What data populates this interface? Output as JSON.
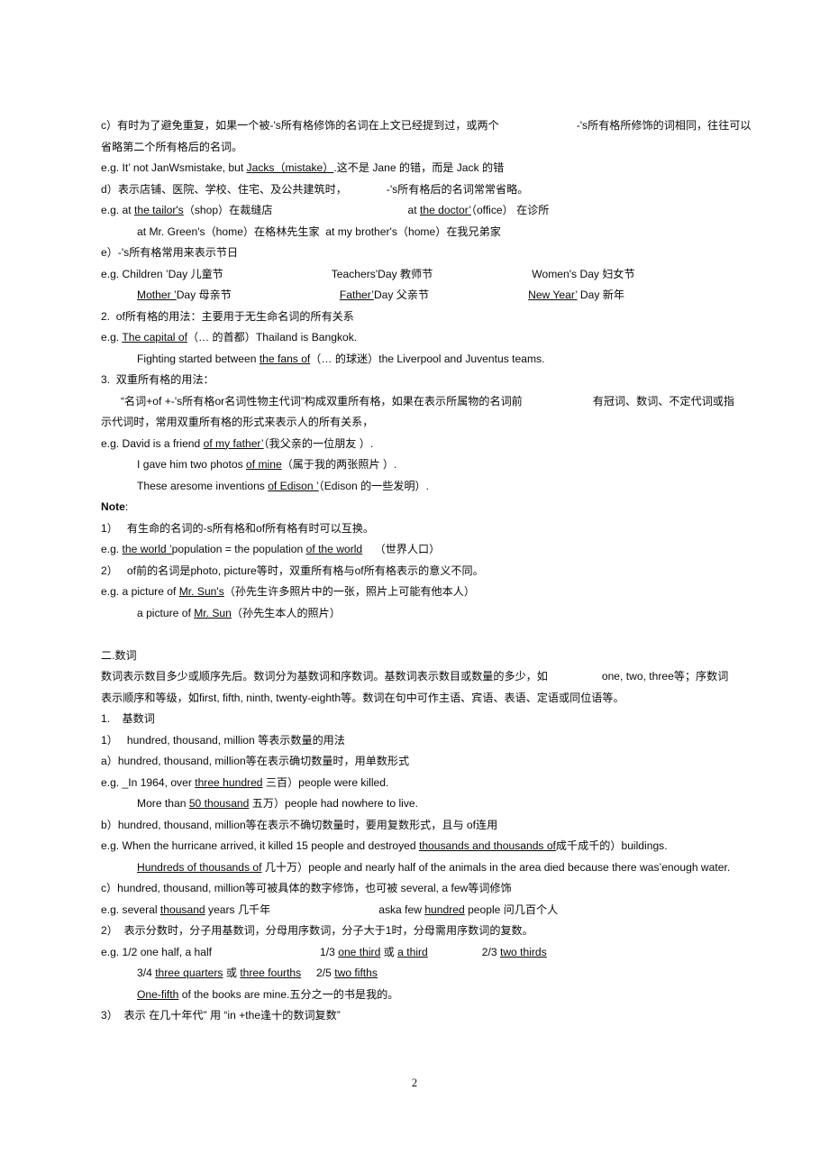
{
  "document": {
    "page_number": "2",
    "lines": [
      {
        "id": "l01",
        "indent": 1,
        "segments": [
          {
            "t": "c）有时为了避免重复，如果一个被-'s所有格修饰的名词在上文已经提到过，或两个"
          },
          {
            "t": "        ",
            "sp": "a"
          },
          {
            "t": "-'s所有格所修饰的词相同，往往可以"
          }
        ]
      },
      {
        "id": "l02",
        "indent": 1,
        "segments": [
          {
            "t": "省略第二个所有格后的名词。"
          }
        ]
      },
      {
        "id": "l03",
        "indent": 1,
        "segments": [
          {
            "t": "e.g. It’ not JanWsmistake, but "
          },
          {
            "t": "Jacks（mistake）",
            "u": true
          },
          {
            "t": ".这不是 Jane 的错，而是 Jack 的错"
          }
        ]
      },
      {
        "id": "l04",
        "indent": 1,
        "segments": [
          {
            "t": "d）表示店铺、医院、学校、住宅、及公共建筑时，"
          },
          {
            "t": "     ",
            "sp": "g"
          },
          {
            "t": "-'s所有格后的名词常常省略。"
          }
        ]
      },
      {
        "id": "l05",
        "indent": 1,
        "segments": [
          {
            "t": "e.g. at "
          },
          {
            "t": "the tailor's",
            "u": true
          },
          {
            "t": "（shop）在裁缝店"
          },
          {
            "t": "        ",
            "sp": "b"
          },
          {
            "t": "at "
          },
          {
            "t": "the doctor’",
            "u": true
          },
          {
            "t": "（office） 在诊所"
          }
        ]
      },
      {
        "id": "l06",
        "indent": 3,
        "segments": [
          {
            "t": "at Mr. Green's（home）在格林先生家  at my brother's（home）在我兄弟家"
          }
        ]
      },
      {
        "id": "l07",
        "indent": 1,
        "segments": [
          {
            "t": "e）-'s所有格常用来表示节日"
          }
        ]
      },
      {
        "id": "l08",
        "indent": 1,
        "segments": [
          {
            "t": "e.g. Children ’Day 儿童节"
          },
          {
            "t": "       ",
            "sp": "c"
          },
          {
            "t": "Teachers'Day 教师节"
          },
          {
            "t": "       ",
            "sp": "d"
          },
          {
            "t": "Women's Day 妇女节"
          }
        ]
      },
      {
        "id": "l09",
        "indent": 3,
        "segments": [
          {
            "t": "Mother ’",
            "u": true
          },
          {
            "t": "Day 母亲节"
          },
          {
            "t": "     ",
            "sp": "c"
          },
          {
            "t": "Father’",
            "u": true
          },
          {
            "t": "Day 父亲节"
          },
          {
            "t": "     ",
            "sp": "d"
          },
          {
            "t": "New Year’",
            "u": true
          },
          {
            "t": " Day 新年"
          }
        ]
      },
      {
        "id": "l10",
        "indent": 1,
        "segments": [
          {
            "t": "2.  of所有格的用法：主要用于无生命名词的所有关系"
          }
        ]
      },
      {
        "id": "l11",
        "indent": 1,
        "segments": [
          {
            "t": "e.g. "
          },
          {
            "t": "The capital of",
            "u": true
          },
          {
            "t": "（… 的首都）Thailand is Bangkok."
          }
        ]
      },
      {
        "id": "l12",
        "indent": 3,
        "segments": [
          {
            "t": "Fighting started between "
          },
          {
            "t": "the fans of",
            "u": true
          },
          {
            "t": "（… 的球迷）the Liverpool and Juventus teams."
          }
        ]
      },
      {
        "id": "l13",
        "indent": 1,
        "segments": [
          {
            "t": "3.  双重所有格的用法："
          }
        ]
      },
      {
        "id": "l14",
        "indent": 2,
        "segments": [
          {
            "t": "“名词+of +-'s所有格or名词性物主代词”构成双重所有格，如果在表示所属物的名词前"
          },
          {
            "t": "        ",
            "sp": "f"
          },
          {
            "t": "有冠词、数词、不定代词或指"
          }
        ]
      },
      {
        "id": "l15",
        "indent": 1,
        "segments": [
          {
            "t": "示代词时，常用双重所有格的形式来表示人的所有关系，"
          }
        ]
      },
      {
        "id": "l16",
        "indent": 1,
        "segments": [
          {
            "t": "e.g. David is a friend "
          },
          {
            "t": "of my father’",
            "u": true
          },
          {
            "t": "（我父亲的一位朋友 ）."
          }
        ]
      },
      {
        "id": "l17",
        "indent": 3,
        "segments": [
          {
            "t": "I gave him two photos "
          },
          {
            "t": "of mine",
            "u": true
          },
          {
            "t": "（属于我的两张照片 ）."
          }
        ]
      },
      {
        "id": "l18",
        "indent": 3,
        "segments": [
          {
            "t": "These aresome inventions "
          },
          {
            "t": "of Edison ’",
            "u": true
          },
          {
            "t": "（Edison 的一些发明）."
          }
        ]
      },
      {
        "id": "l19",
        "indent": 1,
        "segments": [
          {
            "t": "Note",
            "b": true
          },
          {
            "t": ":"
          }
        ]
      },
      {
        "id": "l20",
        "indent": 1,
        "segments": [
          {
            "t": "1）   有生命的名词的-s所有格和of所有格有时可以互换。"
          }
        ]
      },
      {
        "id": "l21",
        "indent": 1,
        "segments": [
          {
            "t": "e.g. "
          },
          {
            "t": "the world ’",
            "u": true
          },
          {
            "t": "population = the population "
          },
          {
            "t": "of the world",
            "u": true
          },
          {
            "t": "    （世界人口）"
          }
        ]
      },
      {
        "id": "l22",
        "indent": 1,
        "segments": [
          {
            "t": "2）   of前的名词是photo, picture等时，双重所有格与of所有格表示的意义不同。"
          }
        ]
      },
      {
        "id": "l23",
        "indent": 1,
        "segments": [
          {
            "t": "e.g. a picture of "
          },
          {
            "t": "Mr. Sun's",
            "u": true
          },
          {
            "t": "（孙先生许多照片中的一张，照片上可能有他本人）"
          }
        ]
      },
      {
        "id": "l24",
        "indent": 3,
        "segments": [
          {
            "t": "a picture of "
          },
          {
            "t": "Mr. Sun",
            "u": true
          },
          {
            "t": "（孙先生本人的照片）"
          }
        ]
      },
      {
        "id": "l25",
        "indent": 1,
        "blank": true,
        "segments": [
          {
            "t": " "
          }
        ]
      },
      {
        "id": "l26",
        "indent": 1,
        "segments": [
          {
            "t": "二.数词"
          }
        ]
      },
      {
        "id": "l27",
        "indent": 1,
        "segments": [
          {
            "t": "数词表示数目多少或顺序先后。数词分为基数词和序数词。基数词表示数目或数量的多少，如"
          },
          {
            "t": "       ",
            "sp": "e"
          },
          {
            "t": "one, two, three等；序数词"
          }
        ]
      },
      {
        "id": "l28",
        "indent": 1,
        "segments": [
          {
            "t": "表示顺序和等级，如first, fifth, ninth, twenty-eighth等。数词在句中可作主语、宾语、表语、定语或同位语等。"
          }
        ]
      },
      {
        "id": "l29",
        "indent": 1,
        "segments": [
          {
            "t": "1.    基数词"
          }
        ]
      },
      {
        "id": "l30",
        "indent": 1,
        "segments": [
          {
            "t": "1）   hundred, thousand, million 等表示数量的用法"
          }
        ]
      },
      {
        "id": "l31",
        "indent": 1,
        "segments": [
          {
            "t": "a）hundred, thousand, million等在表示确切数量时，用单数形式"
          }
        ]
      },
      {
        "id": "l32",
        "indent": 1,
        "segments": [
          {
            "t": "e.g. _In 1964, over "
          },
          {
            "t": "three hundred",
            "u": true
          },
          {
            "t": " 三百）people were killed."
          }
        ]
      },
      {
        "id": "l33",
        "indent": 3,
        "segments": [
          {
            "t": "More than "
          },
          {
            "t": "50 thousand",
            "u": true
          },
          {
            "t": " 五万）people had nowhere to live."
          }
        ]
      },
      {
        "id": "l34",
        "indent": 1,
        "segments": [
          {
            "t": "b）hundred, thousand, million等在表示不确切数量时，要用复数形式，且与 of连用"
          }
        ]
      },
      {
        "id": "l35",
        "indent": 1,
        "segments": [
          {
            "t": "e.g. When the hurricane arrived, it killed 15 people and destroyed "
          },
          {
            "t": "thousands and thousands of",
            "u": true
          },
          {
            "t": "成千成千的）buildings."
          }
        ]
      },
      {
        "id": "l36",
        "indent": 3,
        "segments": [
          {
            "t": "Hundreds of thousands of",
            "u": true
          },
          {
            "t": " 几十万）people and nearly half of the animals in the area died because there was’enough water."
          }
        ]
      },
      {
        "id": "l37",
        "indent": 1,
        "segments": [
          {
            "t": "c）hundred, thousand, million等可被具体的数字修饰，也可被 several, a few等词修饰"
          }
        ]
      },
      {
        "id": "l38",
        "indent": 1,
        "segments": [
          {
            "t": "e.g. several "
          },
          {
            "t": "thousand",
            "u": true
          },
          {
            "t": " years 几千年"
          },
          {
            "t": "      ",
            "sp": "c"
          },
          {
            "t": "aska few "
          },
          {
            "t": "hundred",
            "u": true
          },
          {
            "t": " people 问几百个人"
          }
        ]
      },
      {
        "id": "l39",
        "indent": 1,
        "segments": [
          {
            "t": "2）  表示分数时，分子用基数词，分母用序数词，分子大于1时，分母需用序数词的复数。"
          }
        ]
      },
      {
        "id": "l40",
        "indent": 1,
        "segments": [
          {
            "t": "e.g. 1/2 one half, a half"
          },
          {
            "t": "        ",
            "sp": "c"
          },
          {
            "t": "1/3 "
          },
          {
            "t": "one third",
            "u": true
          },
          {
            "t": " 或 "
          },
          {
            "t": "a third",
            "u": true
          },
          {
            "t": "      ",
            "sp": "e"
          },
          {
            "t": "2/3 "
          },
          {
            "t": "two thirds",
            "u": true
          }
        ]
      },
      {
        "id": "l41",
        "indent": 3,
        "segments": [
          {
            "t": "3/4 "
          },
          {
            "t": "three quarters",
            "u": true
          },
          {
            "t": " 或 "
          },
          {
            "t": "three fourths",
            "u": true
          },
          {
            "t": "     "
          },
          {
            "t": "2/5 "
          },
          {
            "t": "two fifths",
            "u": true
          }
        ]
      },
      {
        "id": "l42",
        "indent": 3,
        "segments": [
          {
            "t": "One-fifth",
            "u": true
          },
          {
            "t": " of the books are mine.五分之一的书是我的。"
          }
        ]
      },
      {
        "id": "l43",
        "indent": 1,
        "segments": [
          {
            "t": "3）  表示 在几十年代” 用 “in +the逢十的数词复数”"
          }
        ]
      }
    ]
  }
}
